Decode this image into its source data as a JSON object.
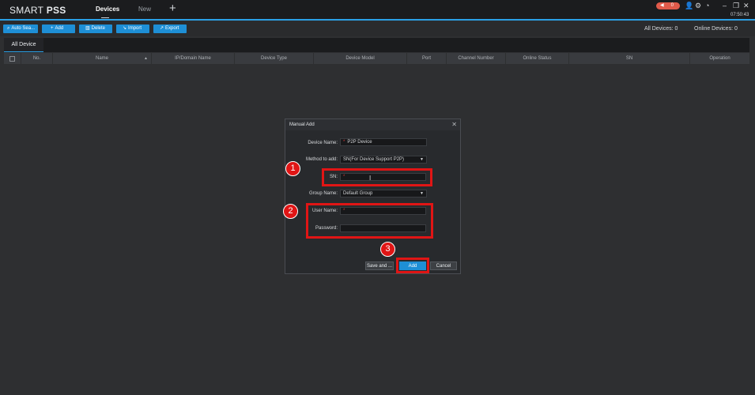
{
  "app": {
    "logo_part1": "SMART ",
    "logo_part2": "PSS",
    "tabs": [
      "Devices",
      "New"
    ],
    "add_tab_icon": "plus-icon",
    "alarm_count": "0",
    "clock": "07:50:43",
    "accent_color": "#2aa0e6"
  },
  "toolbar": {
    "buttons": [
      {
        "label": "Auto Sea...",
        "icon": "search-icon"
      },
      {
        "label": "Add",
        "icon": "plus-icon"
      },
      {
        "label": "Delete",
        "icon": "trash-icon"
      },
      {
        "label": "Import",
        "icon": "import-icon"
      },
      {
        "label": "Export",
        "icon": "export-icon"
      }
    ],
    "all_devices_label": "All Devices:",
    "all_devices_count": "0",
    "online_devices_label": "Online Devices:",
    "online_devices_count": "0"
  },
  "device_tab": "All Device",
  "table": {
    "columns": [
      "No.",
      "Name",
      "IP/Domain Name",
      "Device Type",
      "Device Model",
      "Port",
      "Channel Number",
      "Online Status",
      "SN",
      "Operation"
    ]
  },
  "dialog": {
    "title": "Manual Add",
    "device_name_label": "Device Name:",
    "device_name_value": "P2P Device",
    "method_label": "Method to add:",
    "method_value": "SN(For Device Support P2P)",
    "sn_label": "SN:",
    "sn_value": "",
    "group_label": "Group Name:",
    "group_value": "Default Group",
    "username_label": "User Name:",
    "username_value": "",
    "password_label": "Password:",
    "password_value": "",
    "required_mark": "*",
    "save_and_label": "Save and ...",
    "add_label": "Add",
    "cancel_label": "Cancel"
  },
  "annotations": {
    "markers": [
      "1",
      "2",
      "3"
    ],
    "highlight_color": "#e01515"
  }
}
